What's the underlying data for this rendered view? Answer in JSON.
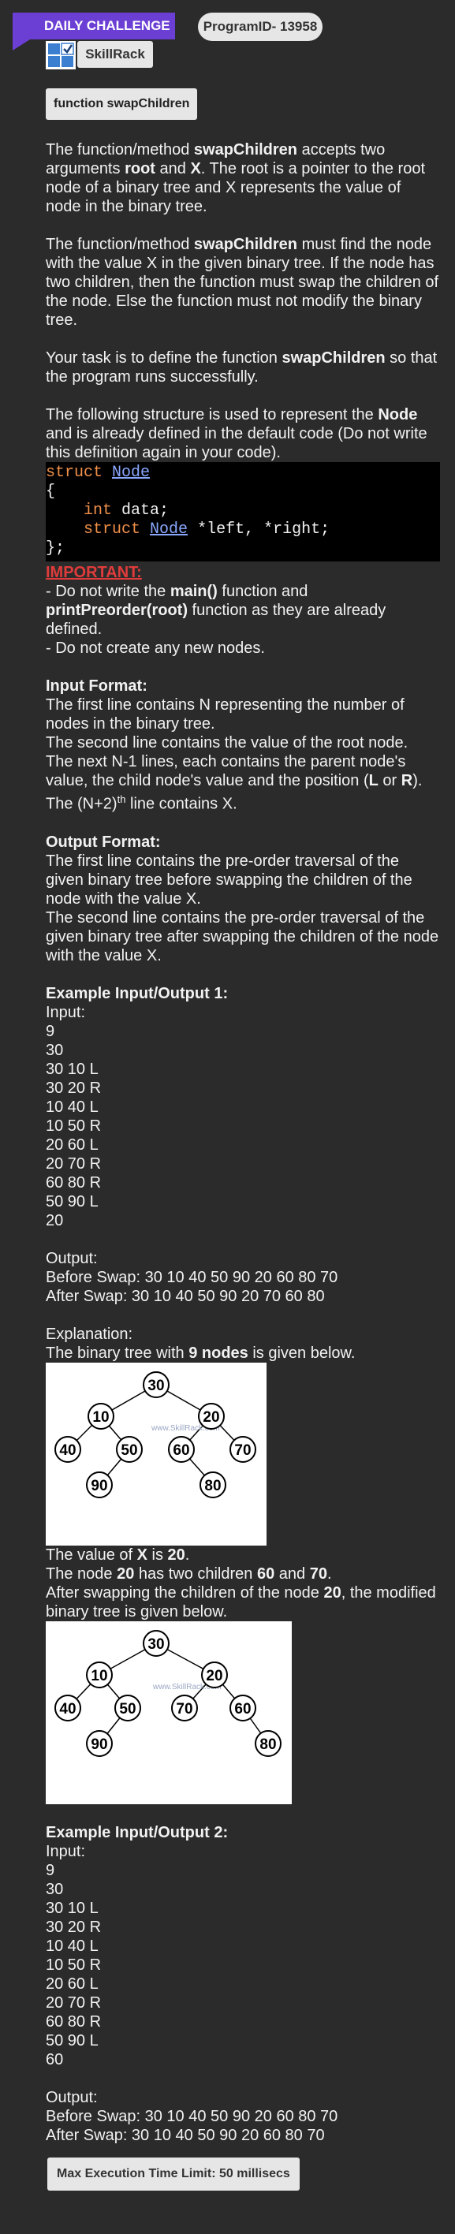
{
  "header": {
    "daily_label": "DAILY CHALLENGE",
    "program_id": "ProgramID- 13958",
    "brand": "SkillRack",
    "accent_color": "#6b3fd4"
  },
  "fn_button": "function swapChildren",
  "intro": {
    "p1_a": "The function/method ",
    "p1_b": "swapChildren",
    "p1_c": " accepts two arguments ",
    "p1_d": "root",
    "p1_e": " and ",
    "p1_f": "X",
    "p1_g": ". The root is a pointer to the root node of a binary tree and X represents the value of node in the binary tree.",
    "p2_a": "The function/method ",
    "p2_b": "swapChildren",
    "p2_c": " must find the node with the value X in the given binary tree. If the node has two children, then the function must swap the children of the node. Else the function must not modify the binary tree.",
    "p3_a": "Your task is to define the function ",
    "p3_b": "swapChildren",
    "p3_c": " so that the program runs successfully.",
    "p4_a": "The following structure is used to represent the ",
    "p4_b": "Node",
    "p4_c": " and is already defined in the default code (Do not write this definition again in your code)."
  },
  "code": {
    "kw_struct": "struct",
    "type_node": "Node",
    "open": "{",
    "kw_int": "int",
    "field_data": " data;",
    "field_ptrs": " *left, *right;",
    "close": "};"
  },
  "important": {
    "title": "IMPORTANT:",
    "l1_a": "- Do not write the ",
    "l1_b": "main()",
    "l1_c": " function and ",
    "l1_d": "printPreorder(root)",
    "l1_e": " function as they are already defined.",
    "l2": "- Do not create any new nodes."
  },
  "input_format": {
    "title": "Input Format:",
    "l1": "The first line contains N representing the number of nodes in the binary tree.",
    "l2": "The second line contains the value of the root node.",
    "l3_a": "The next N-1 lines, each contains the parent node's value, the child node's value and the position (",
    "l3_b": "L",
    "l3_c": " or ",
    "l3_d": "R",
    "l3_e": ").",
    "l4_a": "The (N+2)",
    "l4_sup": "th",
    "l4_b": " line contains X."
  },
  "output_format": {
    "title": "Output Format:",
    "l1": "The first line contains the pre-order traversal of the given binary tree before swapping the children of the node with the value X.",
    "l2": "The second line contains the pre-order traversal of the given binary tree after swapping the children of the node with the value X."
  },
  "example1": {
    "title": "Example Input/Output 1:",
    "input_label": "Input:",
    "input_lines": [
      "9",
      "30",
      "30 10 L",
      "30 20 R",
      "10 40 L",
      "10 50 R",
      "20 60 L",
      "20 70 R",
      "60 80 R",
      "50 90 L",
      "20"
    ],
    "output_label": "Output:",
    "before": "Before Swap: 30 10 40 50 90 20 60 80 70",
    "after": "After Swap: 30 10 40 50 90 20 70 60 80",
    "explanation_label": "Explanation:",
    "exp_a": "The binary tree with ",
    "exp_b": "9 nodes",
    "exp_c": " is given below.",
    "tree1_nodes": [
      "30",
      "10",
      "20",
      "40",
      "50",
      "60",
      "70",
      "90",
      "80"
    ],
    "watermark": "www.SkillRack.com",
    "v_a": "The value of ",
    "v_b": "X",
    "v_c": " is ",
    "v_d": "20",
    "v_e": ".",
    "n_a": "The node ",
    "n_b": "20",
    "n_c": " has two children ",
    "n_d": "60",
    "n_e": " and ",
    "n_f": "70",
    "n_g": ".",
    "s_a": "After swapping the children of the node ",
    "s_b": "20",
    "s_c": ", the modified binary tree is given below.",
    "tree2_nodes": [
      "30",
      "10",
      "20",
      "40",
      "50",
      "70",
      "60",
      "90",
      "80"
    ]
  },
  "example2": {
    "title": "Example Input/Output 2:",
    "input_label": "Input:",
    "input_lines": [
      "9",
      "30",
      "30 10 L",
      "30 20 R",
      "10 40 L",
      "10 50 R",
      "20 60 L",
      "20 70 R",
      "60 80 R",
      "50 90 L",
      "60"
    ],
    "output_label": "Output:",
    "before": "Before Swap: 30 10 40 50 90 20 60 80 70",
    "after": "After Swap: 30 10 40 50 90 20 60 80 70"
  },
  "footer": {
    "time_limit": "Max Execution Time Limit: 50 millisecs"
  }
}
